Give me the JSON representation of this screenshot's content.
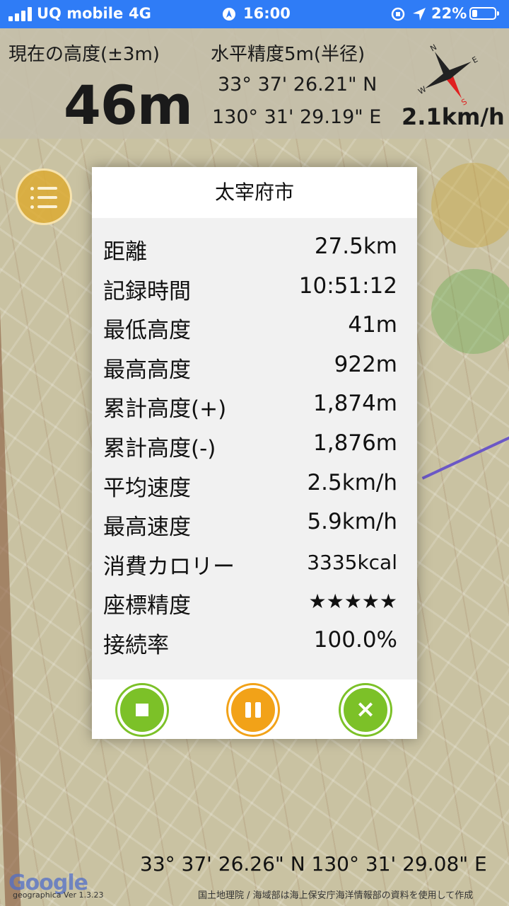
{
  "status_bar": {
    "carrier": "UQ mobile",
    "network": "4G",
    "time": "16:00",
    "battery": "22%",
    "battery_level": 0.22,
    "icons": [
      "signal-icon",
      "location-arrow-icon",
      "orientation-lock-icon",
      "battery-icon"
    ]
  },
  "header": {
    "altitude_label": "現在の高度(±3m)",
    "altitude_value": "46m",
    "accuracy_label": "水平精度5m(半径)",
    "latitude": "33° 37' 26.21\" N",
    "longitude": "130° 31' 29.19\" E",
    "speed": "2.1km/h"
  },
  "dialog": {
    "title": "太宰府市",
    "stats": [
      {
        "label": "距離",
        "value": "27.5km"
      },
      {
        "label": "記録時間",
        "value": "10:51:12"
      },
      {
        "label": "最低高度",
        "value": "41m"
      },
      {
        "label": "最高高度",
        "value": "922m"
      },
      {
        "label": "累計高度(+)",
        "value": "1,874m"
      },
      {
        "label": "累計高度(-)",
        "value": "1,876m"
      },
      {
        "label": "平均速度",
        "value": "2.5km/h"
      },
      {
        "label": "最高速度",
        "value": "5.9km/h"
      },
      {
        "label": "消費カロリー",
        "value": "3335kcal"
      },
      {
        "label": "座標精度",
        "value": "★★★★★"
      },
      {
        "label": "接続率",
        "value": "100.0%"
      }
    ]
  },
  "bottom": {
    "coordinates": "33° 37' 26.26\" N 130° 31' 29.08\" E",
    "google": "Google",
    "version": "geographica Ver 1.3.23",
    "attribution": "国土地理院 / 海域部は海上保安庁海洋情報部の資料を使用して作成"
  },
  "colors": {
    "status_bar": "#2f7cf6",
    "stop_button": "#7cc128",
    "pause_button": "#f2a218",
    "close_button": "#7cc128",
    "menu_button": "#dcaa32"
  }
}
